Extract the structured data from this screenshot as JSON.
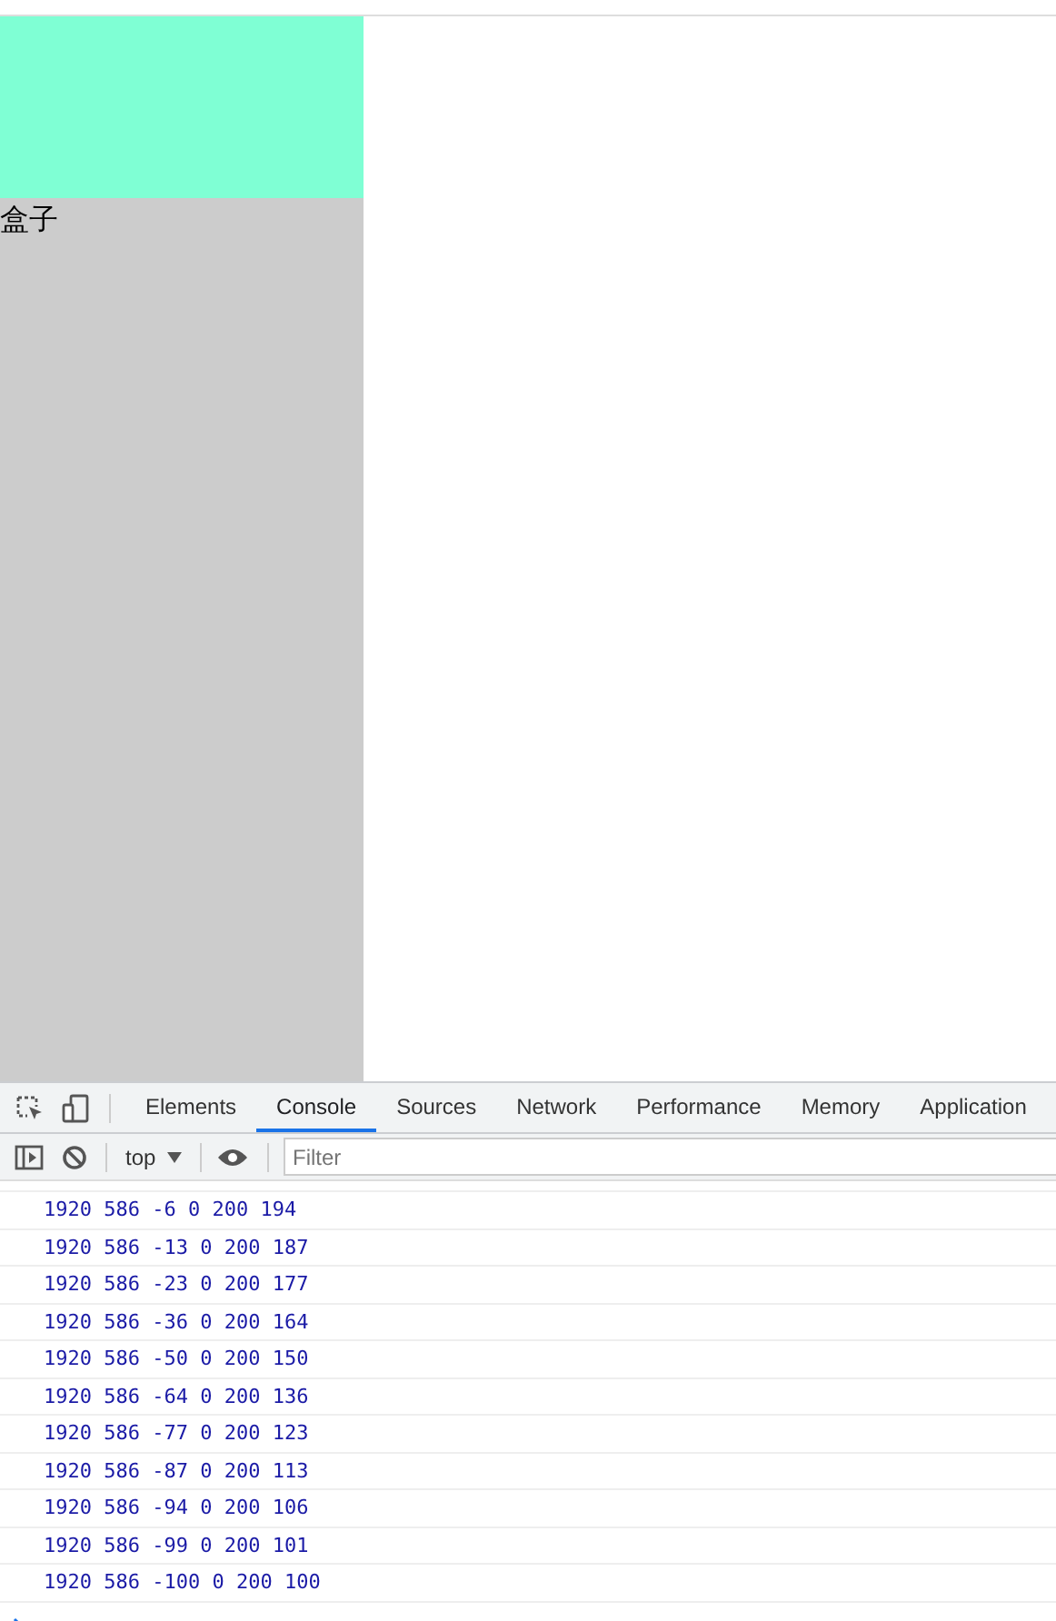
{
  "page": {
    "box_label": "盒子"
  },
  "devtools": {
    "tabs": [
      {
        "label": "Elements",
        "selected": false
      },
      {
        "label": "Console",
        "selected": true
      },
      {
        "label": "Sources",
        "selected": false
      },
      {
        "label": "Network",
        "selected": false
      },
      {
        "label": "Performance",
        "selected": false
      },
      {
        "label": "Memory",
        "selected": false
      },
      {
        "label": "Application",
        "selected": false
      }
    ],
    "context": "top",
    "filter": {
      "placeholder": "Filter"
    },
    "log": [
      "1920 586 -6 0 200 194",
      "1920 586 -13 0 200 187",
      "1920 586 -23 0 200 177",
      "1920 586 -36 0 200 164",
      "1920 586 -50 0 200 150",
      "1920 586 -64 0 200 136",
      "1920 586 -77 0 200 123",
      "1920 586 -87 0 200 113",
      "1920 586 -94 0 200 106",
      "1920 586 -99 0 200 101",
      "1920 586 -100 0 200 100"
    ]
  }
}
